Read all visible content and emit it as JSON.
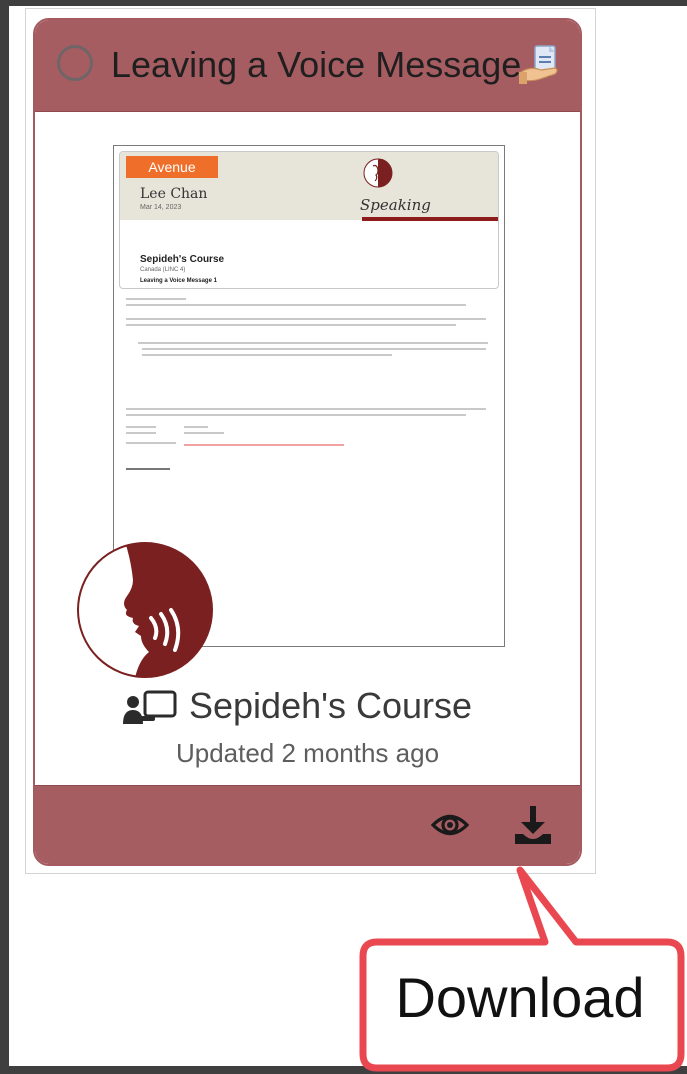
{
  "card": {
    "title": "Leaving a Voice Message 1",
    "course": "Sepideh's Course",
    "updated": "Updated 2 months ago"
  },
  "preview": {
    "tag": "Avenue",
    "student": "Lee Chan",
    "date": "Mar 14, 2023",
    "section": "Speaking",
    "course": "Sepideh's Course",
    "course_sub": "Canada (LINC 4)",
    "item": "Leaving a Voice Message 1",
    "files_label": "Files Included"
  },
  "callout": {
    "label": "Download"
  },
  "icons": {
    "status": "status-circle-icon",
    "title": "document-hand-icon",
    "avatar": "speaking-head-icon",
    "course": "classroom-teacher-icon",
    "view": "eye-icon",
    "download": "download-icon"
  },
  "colors": {
    "card_header": "#a65d62",
    "card_border": "#a45a5f",
    "callout_border": "#ea4850",
    "avatar_red": "#7a2020",
    "tag_orange": "#ef6e2a"
  }
}
